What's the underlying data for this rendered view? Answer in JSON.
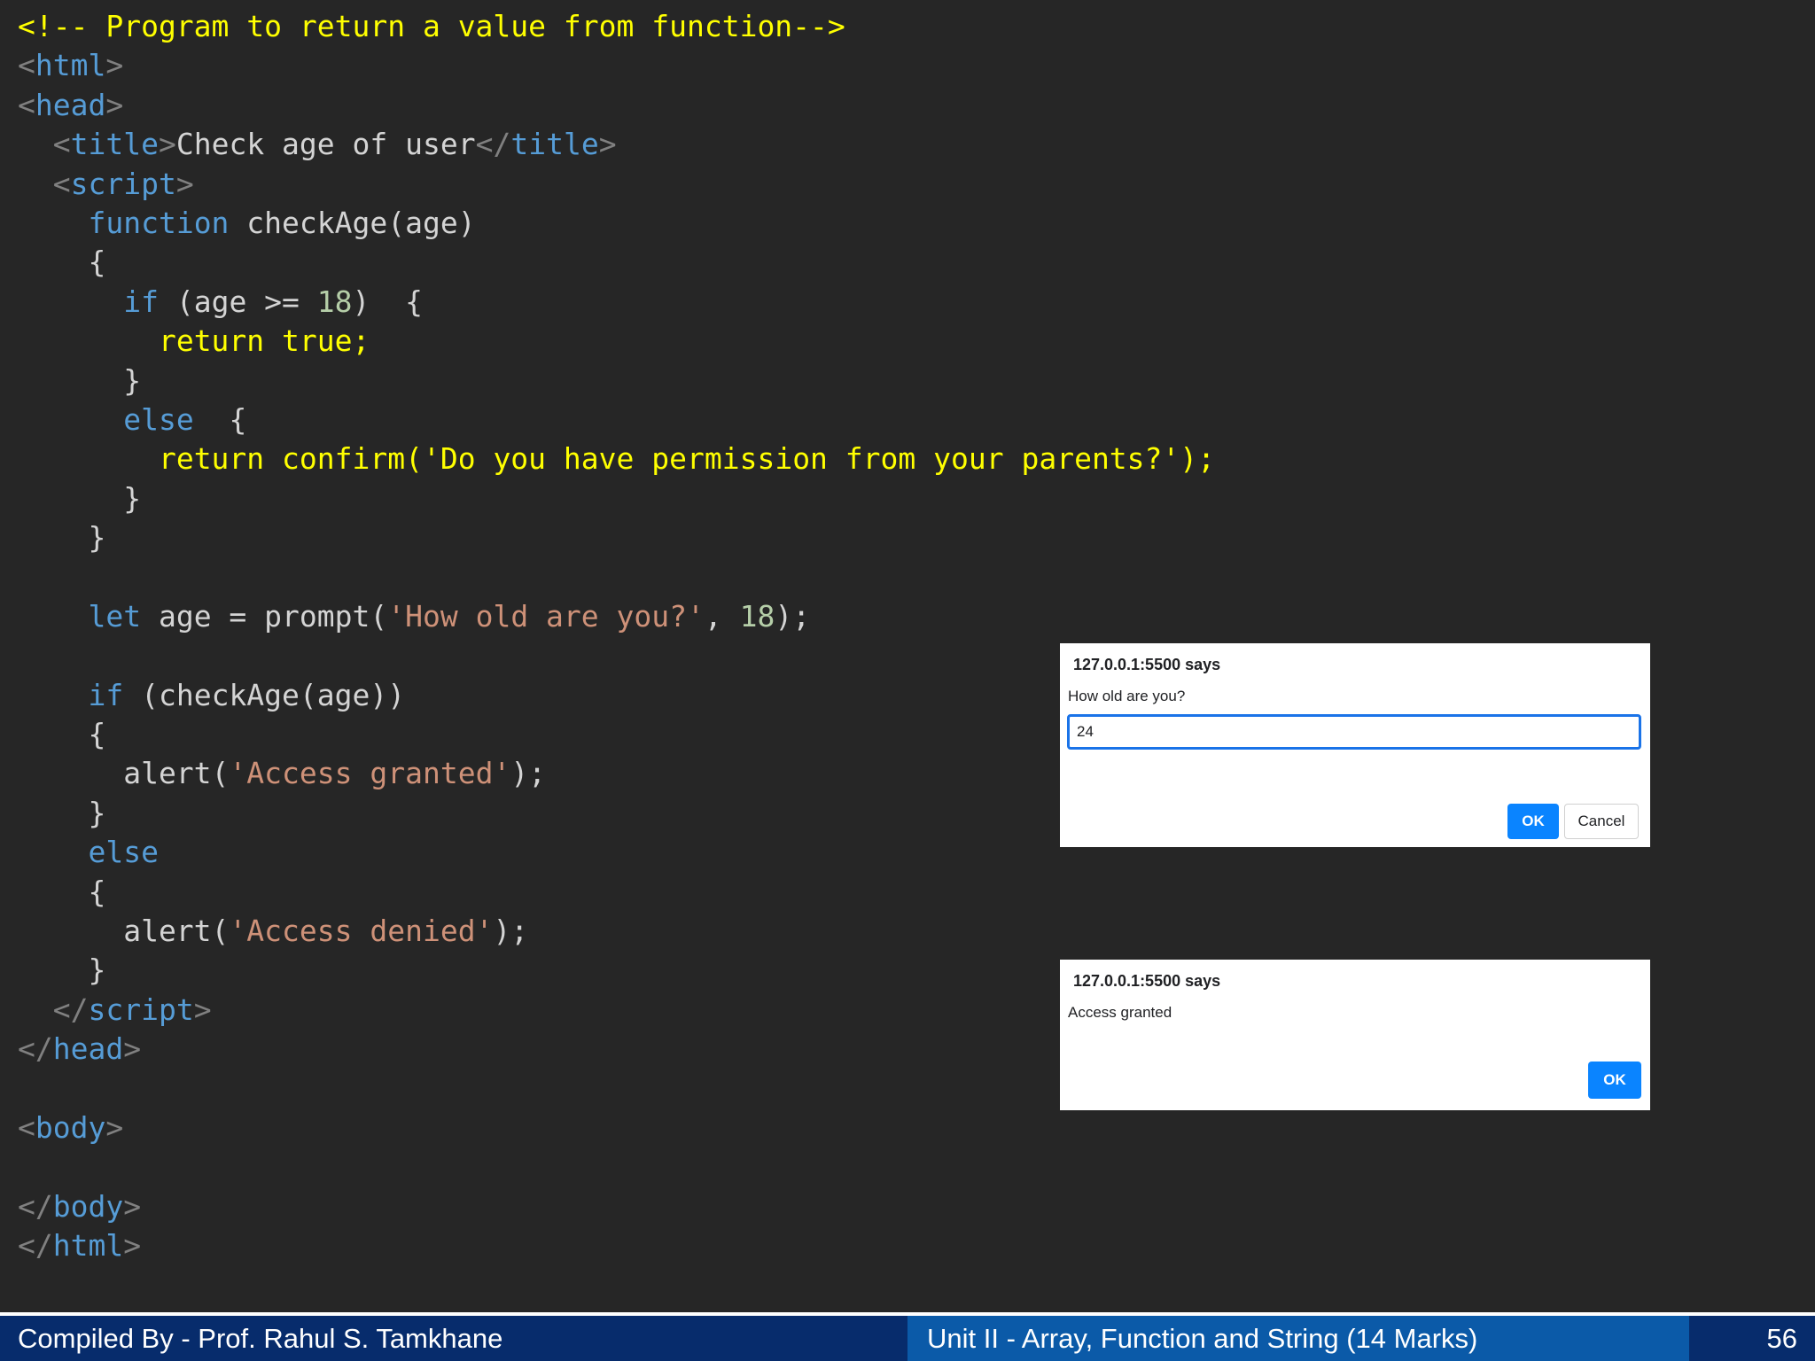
{
  "code": {
    "lines": [
      [
        [
          "comment",
          "<!-- Program to return a value from function-->"
        ]
      ],
      [
        [
          "punct",
          "<"
        ],
        [
          "tag",
          "html"
        ],
        [
          "punct",
          ">"
        ]
      ],
      [
        [
          "punct",
          "<"
        ],
        [
          "tag",
          "head"
        ],
        [
          "punct",
          ">"
        ]
      ],
      [
        [
          "plain",
          "  "
        ],
        [
          "punct",
          "<"
        ],
        [
          "tag",
          "title"
        ],
        [
          "punct",
          ">"
        ],
        [
          "plain",
          "Check age of user"
        ],
        [
          "punct",
          "</"
        ],
        [
          "tag",
          "title"
        ],
        [
          "punct",
          ">"
        ]
      ],
      [
        [
          "plain",
          "  "
        ],
        [
          "punct",
          "<"
        ],
        [
          "tag",
          "script"
        ],
        [
          "punct",
          ">"
        ]
      ],
      [
        [
          "plain",
          "    "
        ],
        [
          "kw",
          "function"
        ],
        [
          "plain",
          " checkAge(age)"
        ]
      ],
      [
        [
          "plain",
          "    {"
        ]
      ],
      [
        [
          "plain",
          "      "
        ],
        [
          "kw",
          "if"
        ],
        [
          "plain",
          " (age >= "
        ],
        [
          "num",
          "18"
        ],
        [
          "plain",
          ")  {"
        ]
      ],
      [
        [
          "plain",
          "        "
        ],
        [
          "hl",
          "return true;"
        ]
      ],
      [
        [
          "plain",
          "      }"
        ]
      ],
      [
        [
          "plain",
          "      "
        ],
        [
          "kw",
          "else"
        ],
        [
          "plain",
          "  {"
        ]
      ],
      [
        [
          "plain",
          "        "
        ],
        [
          "hl",
          "return confirm('Do you have permission from your parents?');"
        ]
      ],
      [
        [
          "plain",
          "      }"
        ]
      ],
      [
        [
          "plain",
          "    }"
        ]
      ],
      [],
      [
        [
          "plain",
          "    "
        ],
        [
          "kw",
          "let"
        ],
        [
          "plain",
          " age = prompt("
        ],
        [
          "str",
          "'How old are you?'"
        ],
        [
          "plain",
          ", "
        ],
        [
          "num",
          "18"
        ],
        [
          "plain",
          ");"
        ]
      ],
      [],
      [
        [
          "plain",
          "    "
        ],
        [
          "kw",
          "if"
        ],
        [
          "plain",
          " (checkAge(age))"
        ]
      ],
      [
        [
          "plain",
          "    {"
        ]
      ],
      [
        [
          "plain",
          "      alert("
        ],
        [
          "str",
          "'Access granted'"
        ],
        [
          "plain",
          ");"
        ]
      ],
      [
        [
          "plain",
          "    }"
        ]
      ],
      [
        [
          "plain",
          "    "
        ],
        [
          "kw",
          "else"
        ]
      ],
      [
        [
          "plain",
          "    {"
        ]
      ],
      [
        [
          "plain",
          "      alert("
        ],
        [
          "str",
          "'Access denied'"
        ],
        [
          "plain",
          ");"
        ]
      ],
      [
        [
          "plain",
          "    }"
        ]
      ],
      [
        [
          "plain",
          "  "
        ],
        [
          "punct",
          "</"
        ],
        [
          "tag",
          "script"
        ],
        [
          "punct",
          ">"
        ]
      ],
      [
        [
          "punct",
          "</"
        ],
        [
          "tag",
          "head"
        ],
        [
          "punct",
          ">"
        ]
      ],
      [],
      [
        [
          "punct",
          "<"
        ],
        [
          "tag",
          "body"
        ],
        [
          "punct",
          ">"
        ]
      ],
      [],
      [
        [
          "punct",
          "</"
        ],
        [
          "tag",
          "body"
        ],
        [
          "punct",
          ">"
        ]
      ],
      [
        [
          "punct",
          "</"
        ],
        [
          "tag",
          "html"
        ],
        [
          "punct",
          ">"
        ]
      ]
    ]
  },
  "prompt_dialog": {
    "title": "127.0.0.1:5500 says",
    "message": "How old are you?",
    "input_value": "24",
    "ok_label": "OK",
    "cancel_label": "Cancel"
  },
  "alert_dialog": {
    "title": "127.0.0.1:5500 says",
    "message": "Access granted",
    "ok_label": "OK"
  },
  "footer": {
    "left": "Compiled By - Prof. Rahul S. Tamkhane",
    "middle": "Unit II - Array, Function and String (14 Marks)",
    "page_number": "56"
  },
  "colors": {
    "background": "#262626",
    "comment": "#ffff00",
    "tag": "#569cd6",
    "keyword": "#569cd6",
    "string": "#ce9178",
    "number": "#b5cea8",
    "highlight": "#ffff00",
    "footer_dark": "#072c6c",
    "footer_mid": "#0b5aa8",
    "dialog_button": "#0a84ff"
  }
}
